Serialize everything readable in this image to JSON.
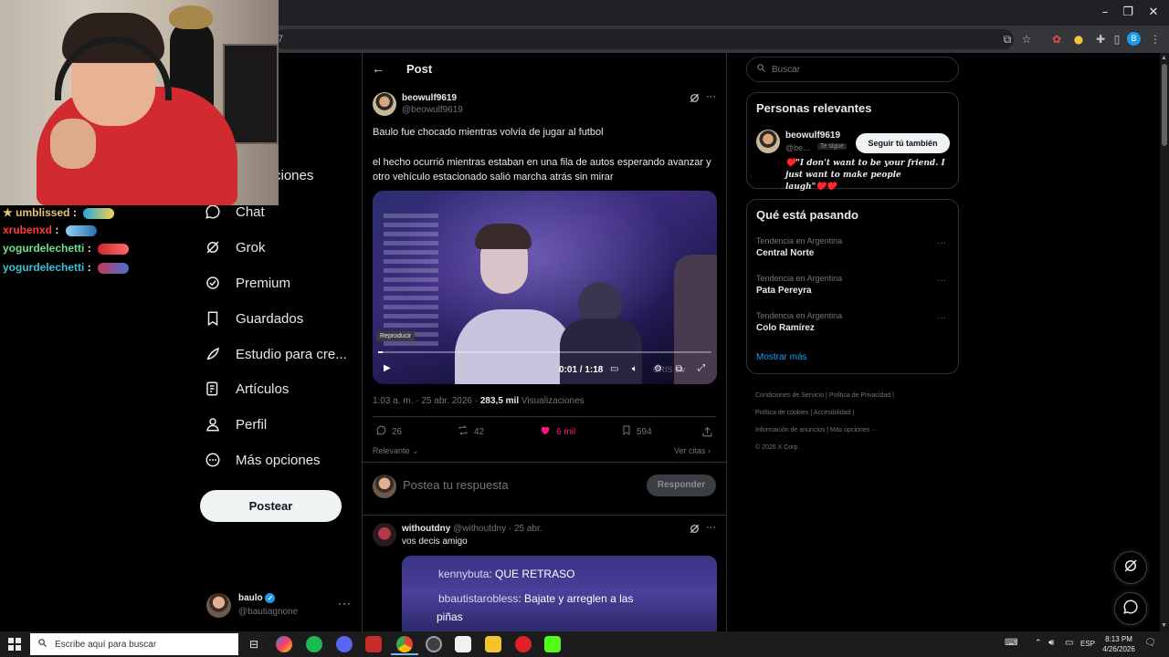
{
  "browser": {
    "url_fragment": "7"
  },
  "chat": [
    {
      "user": "umblissed",
      "color": "#e2c27a",
      "badge": "★",
      "sep": ":"
    },
    {
      "user": "xrubenxd",
      "color": "#ff3b3b",
      "badge": "",
      "sep": ":"
    },
    {
      "user": "yogurdelechetti",
      "color": "#6ee28c",
      "badge": "",
      "sep": ":"
    },
    {
      "user": "yogurdelechetti",
      "color": "#39c2d7",
      "badge": "",
      "sep": ":"
    }
  ],
  "nav": {
    "partial_item": "ciones",
    "items": [
      {
        "label": "Chat",
        "icon": "chat-bubble-icon"
      },
      {
        "label": "Grok",
        "icon": "grok-icon"
      },
      {
        "label": "Premium",
        "icon": "premium-icon"
      },
      {
        "label": "Guardados",
        "icon": "bookmark-icon"
      },
      {
        "label": "Estudio para cre...",
        "icon": "rocket-icon"
      },
      {
        "label": "Artículos",
        "icon": "article-icon"
      },
      {
        "label": "Perfil",
        "icon": "person-icon"
      },
      {
        "label": "Más opciones",
        "icon": "more-circle-icon"
      }
    ],
    "post_button": "Postear",
    "account": {
      "name": "baulo",
      "handle": "@bautiagnone"
    }
  },
  "post": {
    "header_title": "Post",
    "author_name": "beowulf9619",
    "author_handle": "@beowulf9619",
    "text_1": "Baulo fue chocado mientras volvía de jugar al futbol",
    "text_2": "el hecho ocurrió mientras estaban en una fila de autos esperando avanzar y otro vehículo estacionado salió marcha atrás sin mirar",
    "video": {
      "tooltip": "Reproducir",
      "time": "0:01 / 1:18",
      "progress": 0.013,
      "watermark": "CRIS Liv"
    },
    "meta_time": "1:03 a. m. · 25 abr. 2026 ·",
    "meta_views_num": "283,5 mil",
    "meta_views_label": "Visualizaciones",
    "stats": {
      "replies": "26",
      "reposts": "42",
      "likes": "6 mil",
      "bookmarks": "594"
    },
    "sort_label": "Relevante",
    "quotes_label": "Ver citas",
    "reply_placeholder": "Postea tu respuesta",
    "reply_button": "Responder"
  },
  "reply": {
    "name": "withoutdny",
    "handle": "@withoutdny",
    "date": "· 25 abr.",
    "text": "vos decis amigo",
    "image_lines": [
      {
        "user": "kennybuta",
        "text": ": QUE RETRASO"
      },
      {
        "user": "bbautistarobless",
        "text": ": Bajate y arreglen a las"
      },
      {
        "user": "",
        "text": "piñas"
      }
    ]
  },
  "sidebar": {
    "search_placeholder": "Buscar",
    "relevant_title": "Personas relevantes",
    "relevant_person": {
      "name": "beowulf9619",
      "handle": "@be...",
      "follows_you": "Te sigue",
      "follow_button": "Seguir tú también",
      "bio": "♥️\"I don't want to be your friend. I just want to make people laugh\"♥️♥️"
    },
    "trends_title": "Qué está pasando",
    "trends": [
      {
        "meta": "Tendencia en Argentina",
        "name": "Central Norte"
      },
      {
        "meta": "Tendencia en Argentina",
        "name": "Pata Pereyra"
      },
      {
        "meta": "Tendencia en Argentina",
        "name": "Colo Ramírez"
      }
    ],
    "show_more": "Mostrar más",
    "footer": [
      "Condiciones de Servicio",
      "Política de Privacidad",
      "Política de cookies",
      "Accesibilidad",
      "Información de anuncios",
      "Más opciones ···",
      "© 2026 X Corp."
    ]
  },
  "taskbar": {
    "search_placeholder": "Escribe aquí para buscar",
    "lang": "ESP",
    "time": "8:13 PM",
    "date": "4/26/2026"
  },
  "colors": {
    "accent": "#1d9bf0",
    "like": "#f91880",
    "background": "#000000"
  }
}
